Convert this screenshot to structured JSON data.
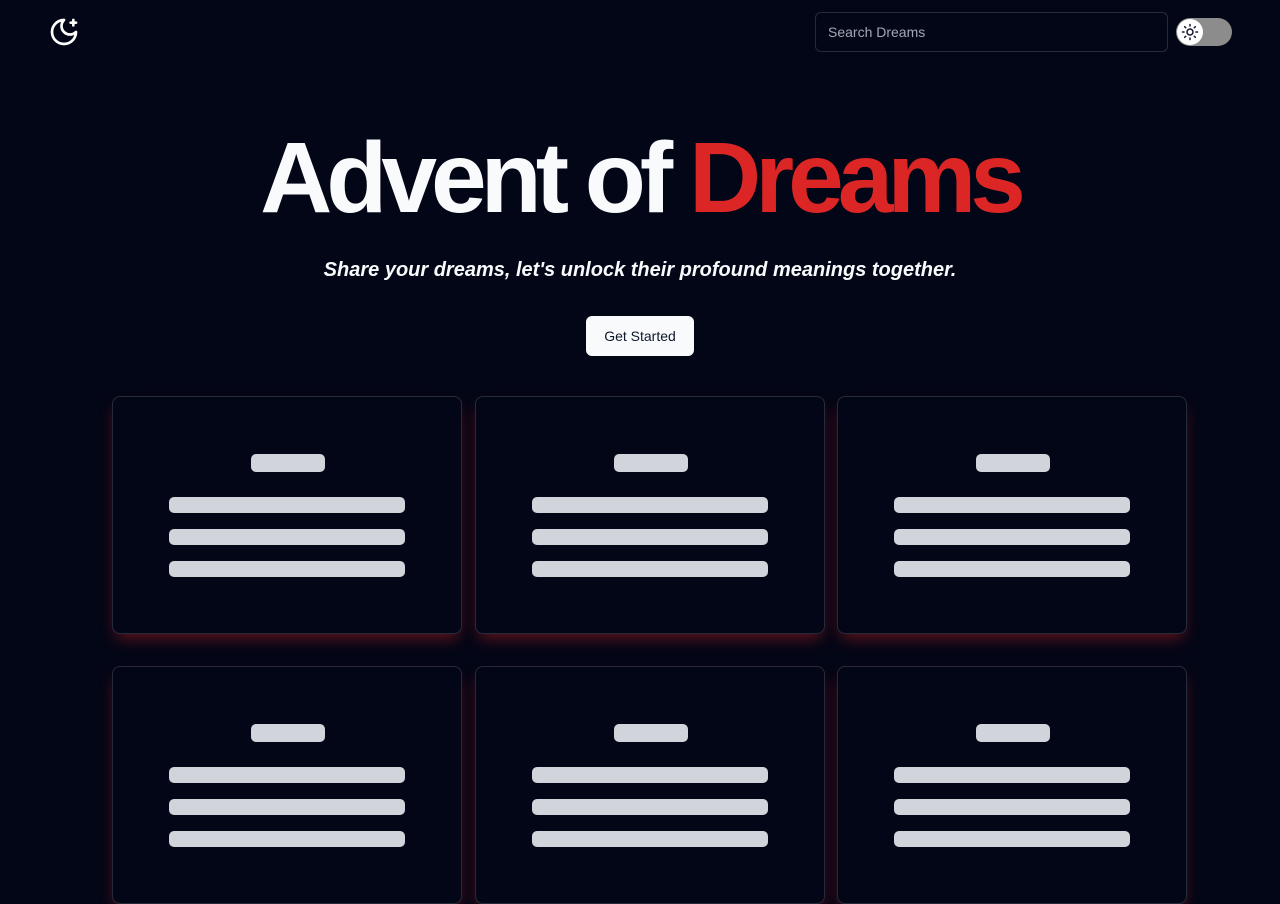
{
  "header": {
    "logo_icon": "moon-star-icon",
    "search": {
      "placeholder": "Search Dreams",
      "value": ""
    },
    "theme_toggle": {
      "icon": "sun-icon",
      "state": "off"
    }
  },
  "hero": {
    "title_part1": "Advent of",
    "title_part2": "Dreams",
    "subtitle": "Share your dreams, let's unlock their profound meanings together.",
    "cta_label": "Get Started"
  },
  "colors": {
    "background": "#030616",
    "accent": "#dc2626",
    "text": "#f8fafc",
    "skeleton": "#d1d5db"
  },
  "cards": {
    "state": "loading-skeleton",
    "count_visible": 6
  }
}
